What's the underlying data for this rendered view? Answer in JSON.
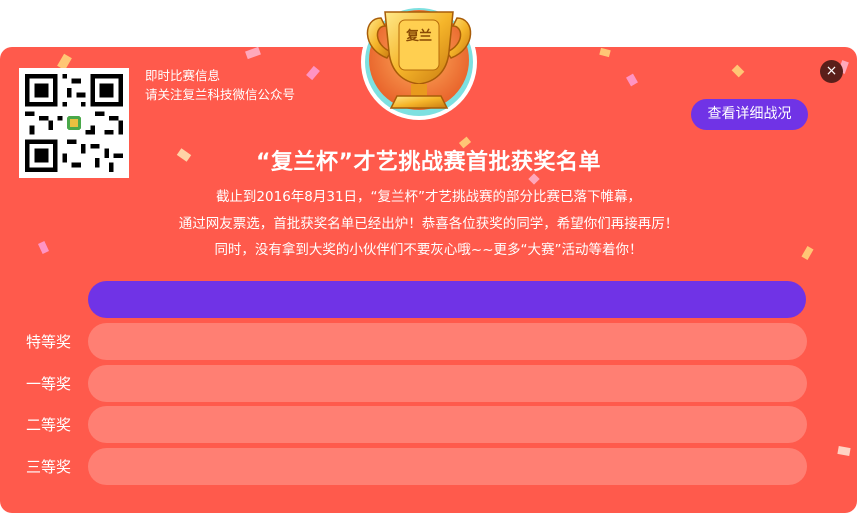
{
  "qr_info": {
    "line1": "即时比赛信息",
    "line2": "请关注复兰科技微信公众号"
  },
  "trophy": {
    "label": "复兰"
  },
  "close": {
    "label": "×"
  },
  "detail_button": {
    "label": "查看详细战况"
  },
  "title": "“复兰杯”才艺挑战赛首批获奖名单",
  "description": [
    "截止到2016年8月31日，“复兰杯”才艺挑战赛的部分比赛已落下帷幕，",
    "通过网友票选，首批获奖名单已经出炉！恭喜各位获奖的同学，希望你们再接再厉！",
    "同时，没有拿到大奖的小伙伴们不要灰心哦~~更多“大赛”活动等着你！"
  ],
  "prizes": [
    {
      "label": "特等奖"
    },
    {
      "label": "一等奖"
    },
    {
      "label": "二等奖"
    },
    {
      "label": "三等奖"
    }
  ],
  "colors": {
    "background": "#ff5a4c",
    "accent_purple": "#7033e6",
    "prize_bar": "#ff7f73"
  }
}
